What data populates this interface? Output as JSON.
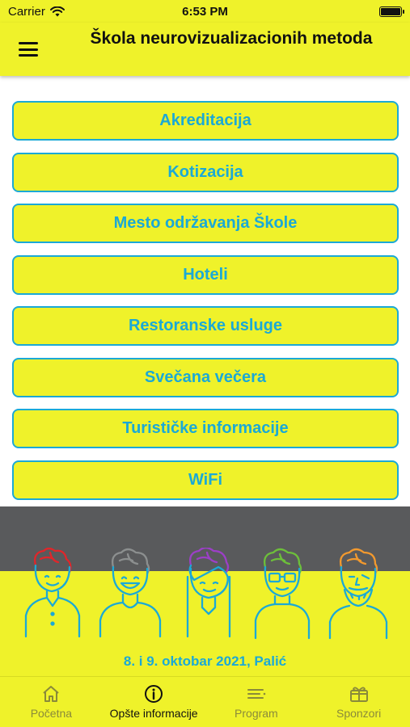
{
  "status_bar": {
    "carrier": "Carrier",
    "time": "6:53 PM"
  },
  "header": {
    "title": "Škola neurovizualizacionih metoda"
  },
  "menu": {
    "items": [
      {
        "label": "Akreditacija"
      },
      {
        "label": "Kotizacija"
      },
      {
        "label": "Mesto održavanja Škole"
      },
      {
        "label": "Hoteli"
      },
      {
        "label": "Restoranske usluge"
      },
      {
        "label": "Svečana večera"
      },
      {
        "label": "Turističke informacije"
      },
      {
        "label": "WiFi"
      }
    ]
  },
  "footer": {
    "event_info": "8. i 9. oktobar 2021, Palić"
  },
  "tabs": [
    {
      "label": "Početna",
      "icon": "home-icon",
      "active": false
    },
    {
      "label": "Opšte informacije",
      "icon": "info-icon",
      "active": true
    },
    {
      "label": "Program",
      "icon": "list-icon",
      "active": false
    },
    {
      "label": "Sponzori",
      "icon": "gift-icon",
      "active": false
    }
  ],
  "colors": {
    "accent_yellow": "#eff22a",
    "accent_blue": "#1ba9d6",
    "band_gray": "#595a5c"
  }
}
